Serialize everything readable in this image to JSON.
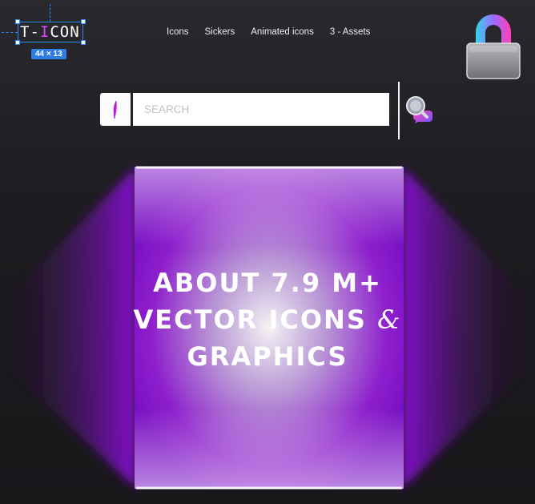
{
  "logo": {
    "prefix": "T-",
    "accent": "I",
    "suffix": "CON",
    "dimension_badge": "44 × 13"
  },
  "nav": {
    "items": [
      "Icons",
      "Sickers",
      "Animated icons",
      "3 - Assets"
    ]
  },
  "search": {
    "placeholder": "SEARCH",
    "value": ""
  },
  "hero": {
    "line1": "ABOUT 7.9 M+",
    "line2": "VECTOR ICONS",
    "ampersand": "&",
    "line3": "GRAPHICS"
  },
  "colors": {
    "background": "#1a191c",
    "accent_purple": "#8a12d6",
    "accent_pink": "#e243ff",
    "selection_blue": "#2f8cff"
  },
  "icons": [
    "lock-icon",
    "search-chat-icon",
    "brush-icon"
  ]
}
